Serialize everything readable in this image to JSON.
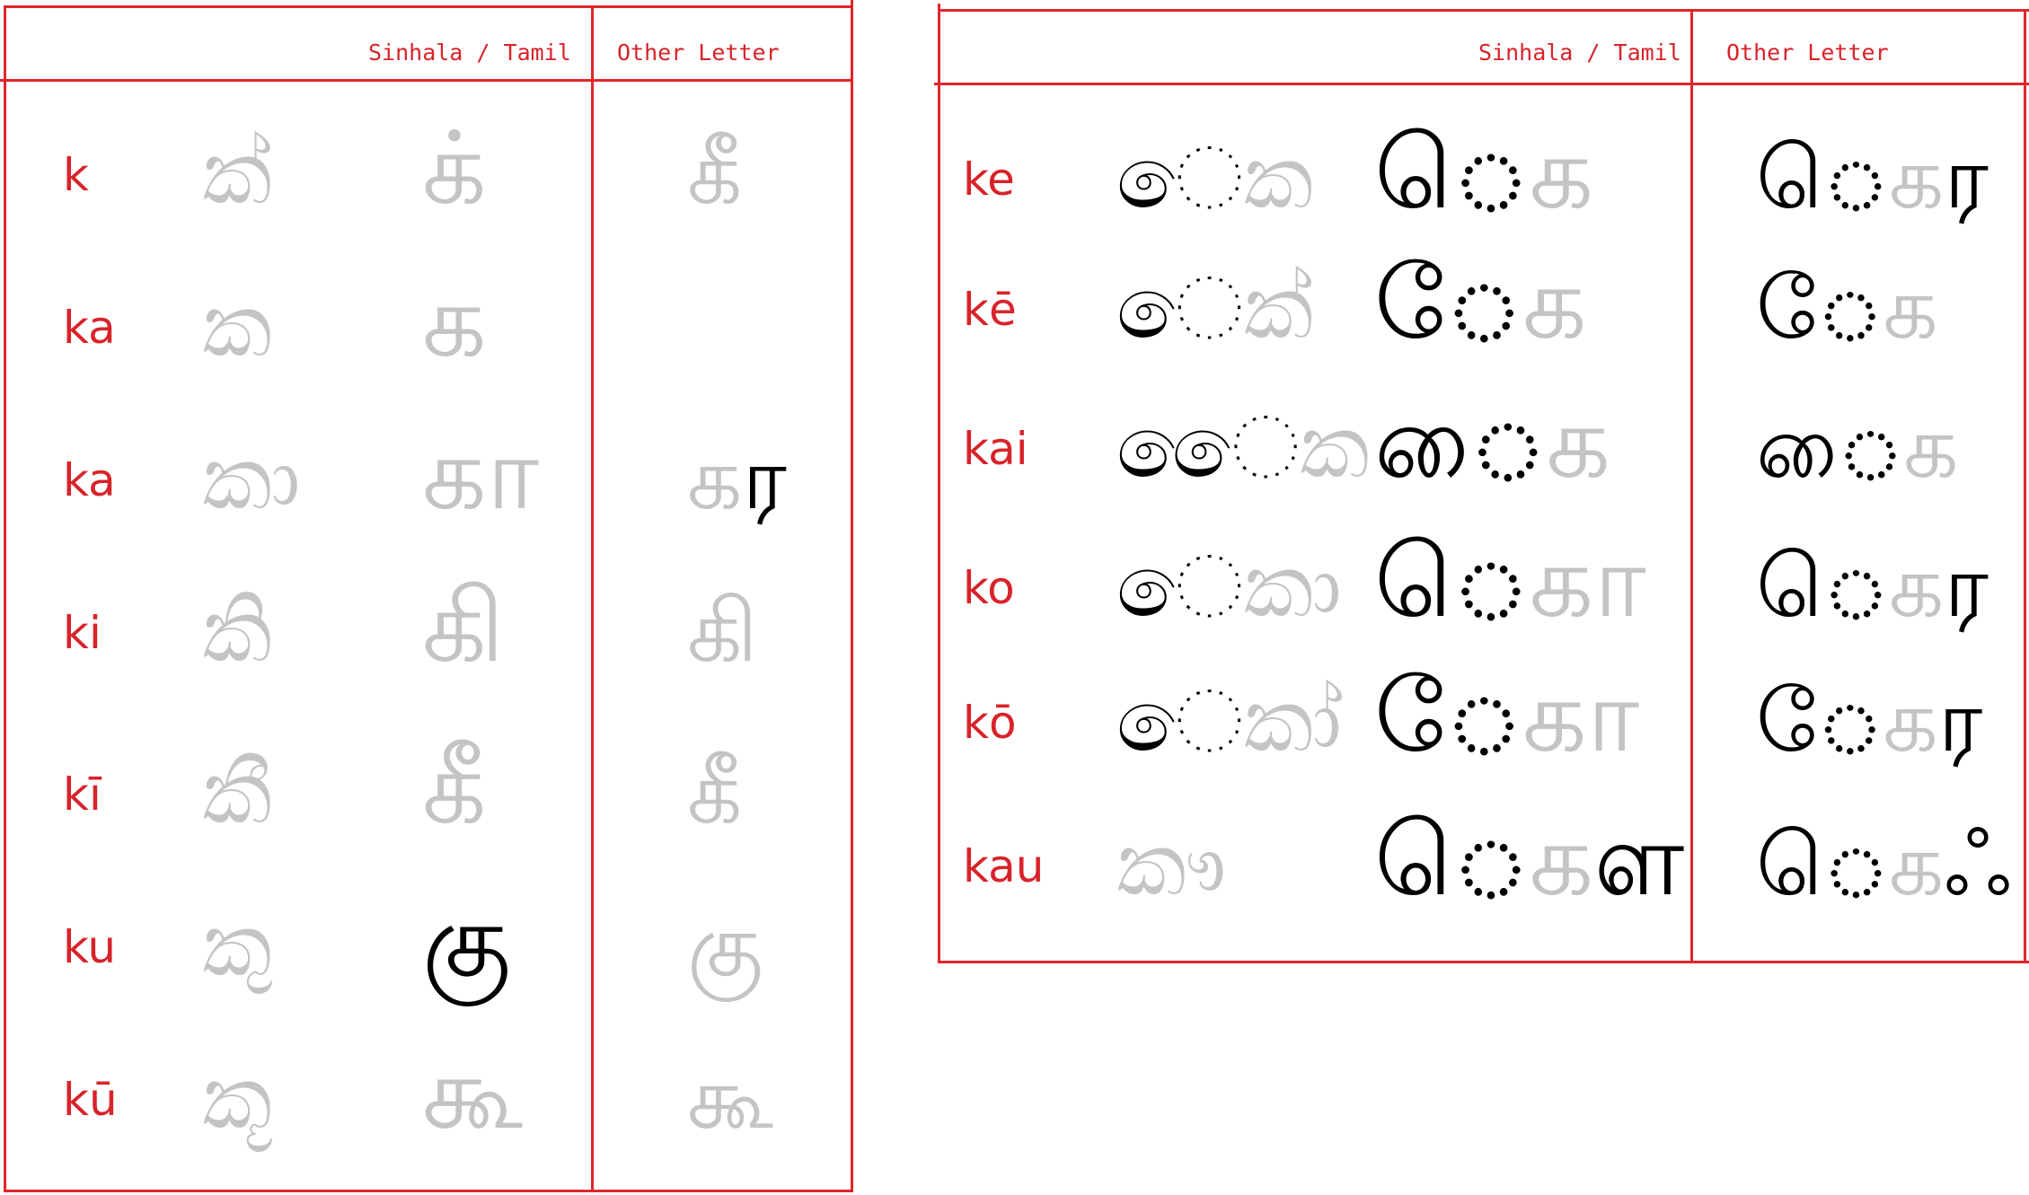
{
  "left_table": {
    "header": {
      "script_col": "Sinhala / Tamil",
      "other_col": "Other Letter"
    },
    "rows": [
      {
        "translit": "k",
        "sinhala": [
          {
            "t": "ක",
            "c": "grey"
          },
          {
            "t": "්",
            "c": "black"
          }
        ],
        "tamil": [
          {
            "t": "க",
            "c": "grey"
          },
          {
            "t": "்",
            "c": "black"
          }
        ],
        "other": [
          {
            "t": "க",
            "c": "grey"
          },
          {
            "t": "ீ",
            "c": "black"
          }
        ]
      },
      {
        "translit": "ka",
        "sinhala": [
          {
            "t": "ක",
            "c": "grey"
          }
        ],
        "tamil": [
          {
            "t": "க",
            "c": "grey"
          }
        ],
        "other": []
      },
      {
        "translit": "ka",
        "sinhala": [
          {
            "t": "ක",
            "c": "grey"
          },
          {
            "t": "ා",
            "c": "black"
          }
        ],
        "tamil": [
          {
            "t": "க",
            "c": "grey"
          },
          {
            "t": "ா",
            "c": "black"
          }
        ],
        "other": [
          {
            "t": "க",
            "c": "grey"
          },
          {
            "t": "ர",
            "c": "black"
          }
        ]
      },
      {
        "translit": "ki",
        "sinhala": [
          {
            "t": "කි",
            "c": "grey"
          }
        ],
        "tamil": [
          {
            "t": "க",
            "c": "grey"
          },
          {
            "t": "ி",
            "c": "black"
          }
        ],
        "other": [
          {
            "t": "க",
            "c": "grey"
          },
          {
            "t": "ி",
            "c": "black"
          }
        ]
      },
      {
        "translit": "kī",
        "sinhala": [
          {
            "t": "කී",
            "c": "grey"
          }
        ],
        "tamil": [
          {
            "t": "க",
            "c": "grey"
          },
          {
            "t": "ீ",
            "c": "black"
          }
        ],
        "other": [
          {
            "t": "க",
            "c": "grey"
          },
          {
            "t": "ீ",
            "c": "black"
          }
        ]
      },
      {
        "translit": "ku",
        "sinhala": [
          {
            "t": "ක",
            "c": "grey"
          },
          {
            "t": "ු",
            "c": "black"
          }
        ],
        "tamil": [
          {
            "t": "கு",
            "c": "black"
          }
        ],
        "other": [
          {
            "t": "க",
            "c": "grey"
          },
          {
            "t": "ு",
            "c": "black"
          }
        ]
      },
      {
        "translit": "kū",
        "sinhala": [
          {
            "t": "ක",
            "c": "grey"
          },
          {
            "t": "ූ",
            "c": "black"
          }
        ],
        "tamil": [
          {
            "t": "க",
            "c": "grey"
          },
          {
            "t": "ூ",
            "c": "black"
          }
        ],
        "other": [
          {
            "t": "க",
            "c": "grey"
          },
          {
            "t": "ூ",
            "c": "black"
          }
        ]
      }
    ]
  },
  "right_table": {
    "header": {
      "script_col": "Sinhala / Tamil",
      "other_col": "Other Letter"
    },
    "rows": [
      {
        "translit": "ke",
        "sinhala": [
          {
            "t": "ෙ",
            "c": "black"
          },
          {
            "t": "ක",
            "c": "grey"
          }
        ],
        "tamil": [
          {
            "t": "ெ",
            "c": "black"
          },
          {
            "t": "க",
            "c": "grey"
          }
        ],
        "other": [
          {
            "t": "ெ",
            "c": "black"
          },
          {
            "t": "க",
            "c": "grey"
          },
          {
            "t": "ர",
            "c": "black"
          }
        ]
      },
      {
        "translit": "kē",
        "sinhala": [
          {
            "t": "ෙ",
            "c": "black"
          },
          {
            "t": "ක්",
            "c": "grey"
          }
        ],
        "tamil": [
          {
            "t": "ே",
            "c": "black"
          },
          {
            "t": "க",
            "c": "grey"
          }
        ],
        "other": [
          {
            "t": "ே",
            "c": "black"
          },
          {
            "t": "க",
            "c": "grey"
          }
        ]
      },
      {
        "translit": "kai",
        "sinhala": [
          {
            "t": "ෛ",
            "c": "black"
          },
          {
            "t": "ක",
            "c": "grey"
          }
        ],
        "tamil": [
          {
            "t": "ை",
            "c": "black"
          },
          {
            "t": "க",
            "c": "grey"
          }
        ],
        "other": [
          {
            "t": "ை",
            "c": "black"
          },
          {
            "t": "க",
            "c": "grey"
          }
        ]
      },
      {
        "translit": "ko",
        "sinhala": [
          {
            "t": "ෙ",
            "c": "black"
          },
          {
            "t": "කා",
            "c": "grey"
          }
        ],
        "tamil": [
          {
            "t": "ெ",
            "c": "black"
          },
          {
            "t": "க",
            "c": "grey"
          },
          {
            "t": "ா",
            "c": "black"
          }
        ],
        "other": [
          {
            "t": "ெ",
            "c": "black"
          },
          {
            "t": "க",
            "c": "grey"
          },
          {
            "t": "ர",
            "c": "black"
          }
        ]
      },
      {
        "translit": "kō",
        "sinhala": [
          {
            "t": "ෙ",
            "c": "black"
          },
          {
            "t": "කා්",
            "c": "grey"
          }
        ],
        "tamil": [
          {
            "t": "ே",
            "c": "black"
          },
          {
            "t": "க",
            "c": "grey"
          },
          {
            "t": "ா",
            "c": "black"
          }
        ],
        "other": [
          {
            "t": "ே",
            "c": "black"
          },
          {
            "t": "க",
            "c": "grey"
          },
          {
            "t": "ர",
            "c": "black"
          }
        ]
      },
      {
        "translit": "kau",
        "sinhala": [
          {
            "t": "ක",
            "c": "grey"
          },
          {
            "t": "ෟ",
            "c": "black"
          }
        ],
        "tamil": [
          {
            "t": "ெ",
            "c": "black"
          },
          {
            "t": "க",
            "c": "grey"
          },
          {
            "t": "ள",
            "c": "black"
          }
        ],
        "other": [
          {
            "t": "ெ",
            "c": "black"
          },
          {
            "t": "க",
            "c": "grey"
          },
          {
            "t": "ஃ",
            "c": "black"
          }
        ]
      }
    ]
  },
  "colors": {
    "rule": "#e0262b",
    "label": "#d8232a",
    "grey_glyph": "#c4c4c4",
    "black_glyph": "#000000"
  }
}
